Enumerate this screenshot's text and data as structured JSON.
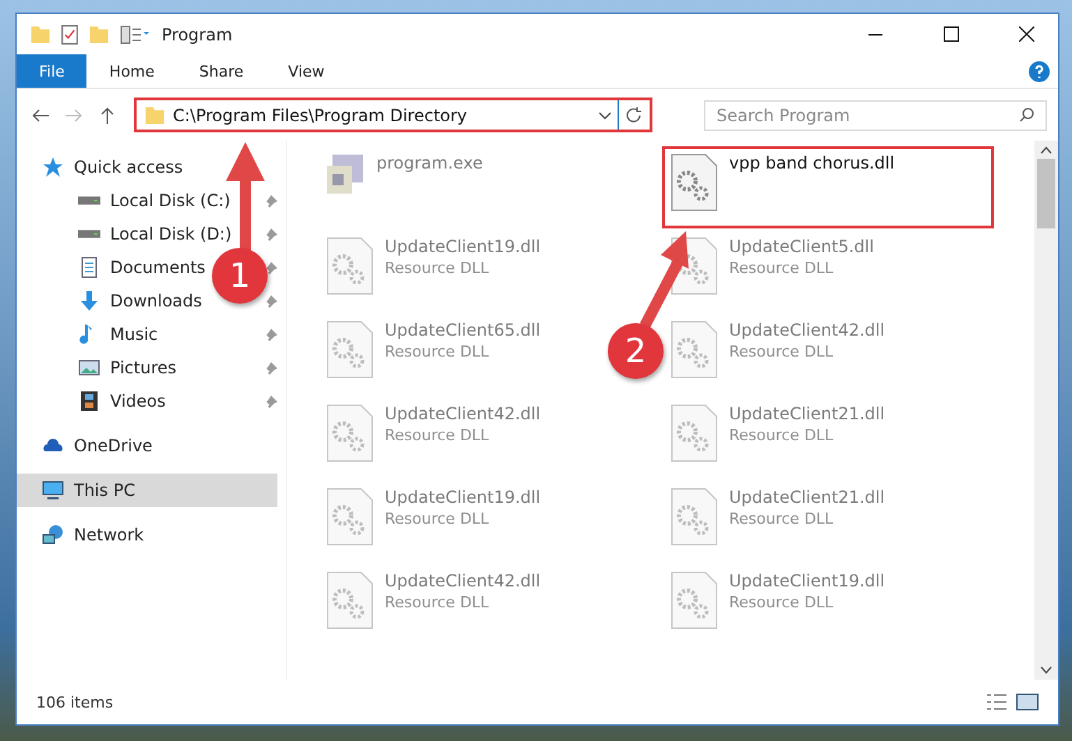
{
  "window": {
    "title": "Program"
  },
  "ribbon_tabs": [
    {
      "label": "File",
      "selected": true
    },
    {
      "label": "Home",
      "selected": false
    },
    {
      "label": "Share",
      "selected": false
    },
    {
      "label": "View",
      "selected": false
    }
  ],
  "address": {
    "path": "C:\\Program Files\\Program Directory",
    "highlighted": true
  },
  "search": {
    "placeholder": "Search Program"
  },
  "sidebar": [
    {
      "label": "Quick access",
      "kind": "star",
      "selected": false,
      "children": [
        {
          "label": "Local Disk (C:)",
          "kind": "disk",
          "pinned": true,
          "selected": false
        },
        {
          "label": "Local Disk (D:)",
          "kind": "disk",
          "pinned": true,
          "selected": false
        },
        {
          "label": "Documents",
          "kind": "documents",
          "pinned": true,
          "selected": false
        },
        {
          "label": "Downloads",
          "kind": "downloads",
          "pinned": true,
          "selected": false
        },
        {
          "label": "Music",
          "kind": "music",
          "pinned": true,
          "selected": false
        },
        {
          "label": "Pictures",
          "kind": "pictures",
          "pinned": true,
          "selected": false
        },
        {
          "label": "Videos",
          "kind": "videos",
          "pinned": true,
          "selected": false
        }
      ]
    },
    {
      "label": "OneDrive",
      "kind": "cloud",
      "selected": false
    },
    {
      "label": "This PC",
      "kind": "pc",
      "selected": true
    },
    {
      "label": "Network",
      "kind": "network",
      "selected": false
    }
  ],
  "files": [
    {
      "name": "program.exe",
      "kind": "exe",
      "blurred": true,
      "highlighted": false
    },
    {
      "name": "vpp band chorus.dll",
      "kind": "dll",
      "blurred": false,
      "highlighted": true
    },
    {
      "name": "UpdateClient19.dll",
      "type": "Resource DLL",
      "kind": "dll",
      "blurred": true,
      "highlighted": false
    },
    {
      "name": "UpdateClient5.dll",
      "type": "Resource DLL",
      "kind": "dll",
      "blurred": true,
      "highlighted": false
    },
    {
      "name": "UpdateClient65.dll",
      "type": "Resource DLL",
      "kind": "dll",
      "blurred": true,
      "highlighted": false
    },
    {
      "name": "UpdateClient42.dll",
      "type": "Resource DLL",
      "kind": "dll",
      "blurred": true,
      "highlighted": false
    },
    {
      "name": "UpdateClient42.dll",
      "type": "Resource DLL",
      "kind": "dll",
      "blurred": true,
      "highlighted": false
    },
    {
      "name": "UpdateClient21.dll",
      "type": "Resource DLL",
      "kind": "dll",
      "blurred": true,
      "highlighted": false
    },
    {
      "name": "UpdateClient19.dll",
      "type": "Resource DLL",
      "kind": "dll",
      "blurred": true,
      "highlighted": false
    },
    {
      "name": "UpdateClient21.dll",
      "type": "Resource DLL",
      "kind": "dll",
      "blurred": true,
      "highlighted": false
    },
    {
      "name": "UpdateClient42.dll",
      "type": "Resource DLL",
      "kind": "dll",
      "blurred": true,
      "highlighted": false
    },
    {
      "name": "UpdateClient19.dll",
      "type": "Resource DLL",
      "kind": "dll",
      "blurred": true,
      "highlighted": false
    }
  ],
  "annotations": [
    {
      "number": "1"
    },
    {
      "number": "2"
    }
  ],
  "status_bar": {
    "count": "106 items"
  }
}
